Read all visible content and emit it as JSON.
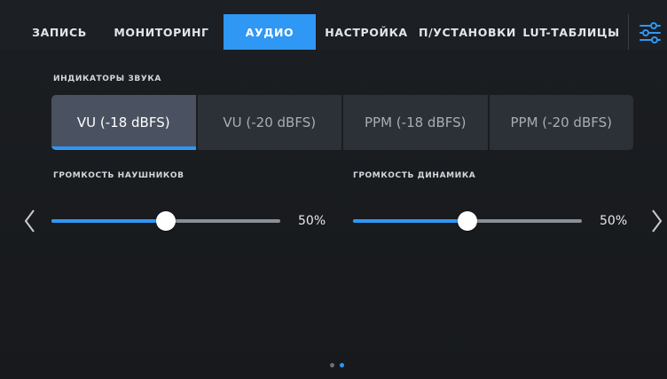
{
  "tabs": [
    {
      "label": "ЗАПИСЬ",
      "active": false
    },
    {
      "label": "МОНИТОРИНГ",
      "active": false
    },
    {
      "label": "АУДИО",
      "active": true
    },
    {
      "label": "НАСТРОЙКА",
      "active": false
    },
    {
      "label": "П/УСТАНОВКИ",
      "active": false
    },
    {
      "label": "LUT-ТАБЛИЦЫ",
      "active": false
    }
  ],
  "settings_icon": "sliders-icon",
  "meters": {
    "label": "ИНДИКАТОРЫ ЗВУКА",
    "options": [
      "VU (-18 dBFS)",
      "VU (-20 dBFS)",
      "PPM (-18 dBFS)",
      "PPM (-20 dBFS)"
    ],
    "selected_index": 0
  },
  "headphones": {
    "label": "ГРОМКОСТЬ НАУШНИКОВ",
    "value": 50,
    "value_text": "50%"
  },
  "speaker": {
    "label": "ГРОМКОСТЬ ДИНАМИКА",
    "value": 50,
    "value_text": "50%"
  },
  "nav": {
    "prev_icon": "chevron-left-icon",
    "next_icon": "chevron-right-icon"
  },
  "pagination": {
    "pages": 2,
    "current": 2
  },
  "colors": {
    "accent": "#2f97f4",
    "selected_bg": "#4a5261",
    "option_bg": "#2c3138",
    "background": "#1a1d21"
  }
}
